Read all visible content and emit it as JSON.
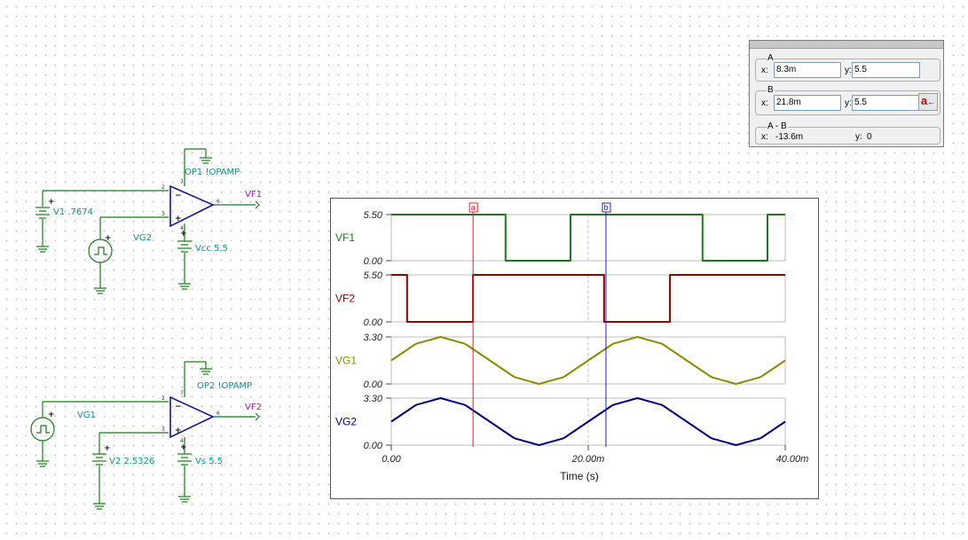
{
  "schematic": {
    "circuit1": {
      "opamp_label": "OP1 !OPAMP",
      "dc_source_label": "V1 .7674",
      "signal_source_label": "VG2",
      "supply_label": "Vcc 5.5",
      "output_label": "VF1",
      "pin_in_minus": "2",
      "pin_in_plus": "3",
      "pin_out": "6",
      "pin_v_plus": "7",
      "pin_v_minus": "4"
    },
    "circuit2": {
      "opamp_label": "OP2 !OPAMP",
      "dc_source_label": "V2 2.5326",
      "signal_source_label": "VG1",
      "supply_label": "Vs 5.5",
      "output_label": "VF2",
      "pin_in_minus": "2",
      "pin_in_plus": "3",
      "pin_out": "6",
      "pin_v_plus": "7",
      "pin_v_minus": "4"
    }
  },
  "cursor_panel": {
    "a": {
      "title": "A",
      "x_label": "x:",
      "x_value": "8.3m",
      "y_label": "y:",
      "y_value": "5.5"
    },
    "b": {
      "title": "B",
      "x_label": "x:",
      "x_value": "21.8m",
      "y_label": "y:",
      "y_value": "5.5",
      "button_label": "a"
    },
    "diff": {
      "title": "A - B",
      "x_label": "x:",
      "x_value": "-13.6m",
      "y_label": "y:",
      "y_value": "0"
    }
  },
  "chart_data": {
    "type": "line",
    "xlabel": "Time (s)",
    "x_ticks": [
      "0.00",
      "20.00m",
      "40.00m"
    ],
    "xlim": [
      0,
      40
    ],
    "cursor_a_x": 8.3,
    "cursor_b_x": 21.8,
    "cursor_a_tag": "a",
    "cursor_b_tag": "b",
    "series": [
      {
        "name": "VF1",
        "color": "#1a7a1a",
        "ymax_label": "5.50",
        "ymin_label": "0.00",
        "ylim": [
          0,
          5.5
        ],
        "x": [
          0,
          11.6,
          11.6,
          18.2,
          18.2,
          31.6,
          31.6,
          38.2,
          38.2,
          40
        ],
        "y": [
          5.5,
          5.5,
          0,
          0,
          5.5,
          5.5,
          0,
          0,
          5.5,
          5.5
        ]
      },
      {
        "name": "VF2",
        "color": "#8b0000",
        "ymax_label": "5.50",
        "ymin_label": "0.00",
        "ylim": [
          0,
          5.5
        ],
        "x": [
          0,
          1.6,
          1.6,
          8.3,
          8.3,
          21.6,
          21.6,
          28.3,
          28.3,
          40
        ],
        "y": [
          5.5,
          5.5,
          0,
          0,
          5.5,
          5.5,
          0,
          0,
          5.5,
          5.5
        ]
      },
      {
        "name": "VG1",
        "color": "#8b8b00",
        "ymax_label": "3.30",
        "ymin_label": "0.00",
        "ylim": [
          0,
          3.3
        ],
        "x": [
          0,
          2.5,
          5,
          7.5,
          10,
          12.5,
          15,
          17.5,
          20,
          22.5,
          25,
          27.5,
          30,
          32.5,
          35,
          37.5,
          40
        ],
        "y": [
          1.65,
          2.82,
          3.3,
          2.82,
          1.65,
          0.48,
          0,
          0.48,
          1.65,
          2.82,
          3.3,
          2.82,
          1.65,
          0.48,
          0,
          0.48,
          1.65
        ]
      },
      {
        "name": "VG2",
        "color": "#00007a",
        "ymax_label": "3.30",
        "ymin_label": "0.00",
        "ylim": [
          0,
          3.3
        ],
        "x": [
          0,
          2.5,
          5,
          7.5,
          10,
          12.5,
          15,
          17.5,
          20,
          22.5,
          25,
          27.5,
          30,
          32.5,
          35,
          37.5,
          40
        ],
        "y": [
          1.65,
          2.82,
          3.3,
          2.82,
          1.65,
          0.48,
          0,
          0.48,
          1.65,
          2.82,
          3.3,
          2.82,
          1.65,
          0.48,
          0,
          0.48,
          1.65
        ]
      }
    ]
  }
}
